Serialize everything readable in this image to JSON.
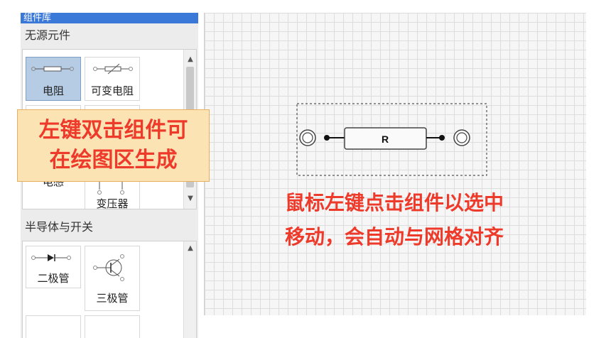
{
  "library": {
    "title": "组件库",
    "groups": [
      {
        "title": "无源元件",
        "items": [
          {
            "label": "电阻",
            "icon": "resistor-icon",
            "selected": true
          },
          {
            "label": "可变电阻",
            "icon": "variable-resistor-icon",
            "selected": false
          },
          {
            "label": "电感",
            "icon": "inductor-icon",
            "selected": false
          },
          {
            "label": "变压器",
            "icon": "transformer-icon",
            "selected": false
          }
        ]
      },
      {
        "title": "半导体与开关",
        "items": [
          {
            "label": "二极管",
            "icon": "diode-icon",
            "selected": false
          },
          {
            "label": "三极管",
            "icon": "transistor-icon",
            "selected": false
          }
        ]
      }
    ]
  },
  "canvas": {
    "component": {
      "label": "R",
      "type": "resistor"
    }
  },
  "annotations": {
    "callout_line1": "左键双击组件可",
    "callout_line2": "在绘图区生成",
    "note_line1": "鼠标左键点击组件以选中",
    "note_line2": "移动，会自动与网格对齐"
  },
  "colors": {
    "annotation_text": "#ee3a2a",
    "callout_bg": "#fbe3b4",
    "selected_tile": "#b5cce4",
    "header_bg": "#3b79d9"
  }
}
